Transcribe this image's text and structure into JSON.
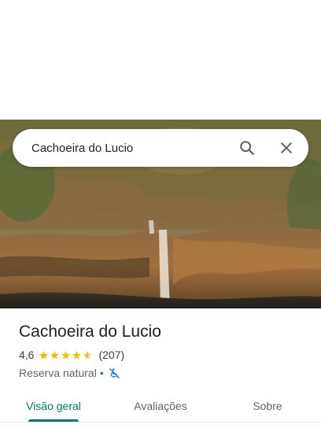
{
  "search": {
    "query": "Cachoeira do Lucio",
    "search_icon": "search-icon",
    "close_icon": "close-icon"
  },
  "place": {
    "name": "Cachoeira do Lucio",
    "rating": "4,6",
    "rating_value": 4.6,
    "review_count": "(207)",
    "category": "Reserva natural",
    "separator": "•",
    "accessibility_icon": "not-wheelchair-accessible-icon"
  },
  "tabs": [
    {
      "label": "Visão geral",
      "active": true
    },
    {
      "label": "Avaliações",
      "active": false
    },
    {
      "label": "Sobre",
      "active": false
    }
  ],
  "colors": {
    "accent": "#00796b",
    "star": "#fbbc04",
    "text_primary": "#202124",
    "text_secondary": "#5f6368",
    "accessibility": "#1a73e8"
  }
}
